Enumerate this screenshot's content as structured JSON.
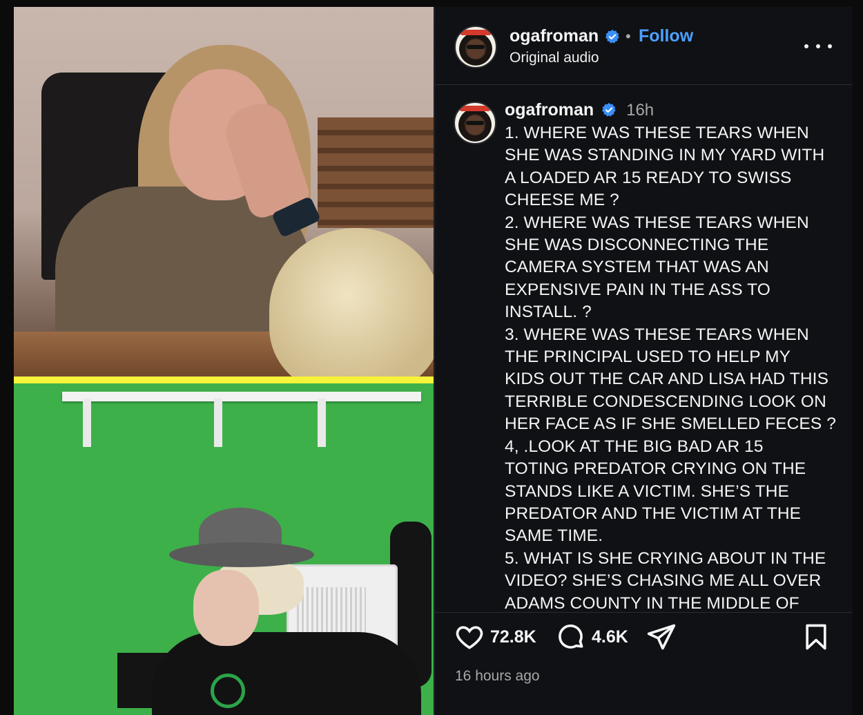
{
  "post": {
    "username": "ogafroman",
    "follow_label": "Follow",
    "separator": "•",
    "audio_label": "Original audio",
    "caption_time": "16h",
    "caption": "1. WHERE WAS THESE TEARS WHEN\nSHE WAS STANDING IN MY YARD WITH\nA LOADED AR 15 READY TO SWISS\nCHEESE ME ?\n2. WHERE WAS THESE TEARS WHEN\nSHE WAS DISCONNECTING THE\nCAMERA SYSTEM THAT WAS AN\nEXPENSIVE PAIN IN THE ASS TO\nINSTALL. ?\n3. WHERE WAS THESE TEARS WHEN\nTHE PRINCIPAL USED TO HELP MY\nKIDS OUT THE CAR AND LISA HAD THIS\nTERRIBLE CONDESCENDING LOOK ON\nHER FACE AS IF SHE SMELLED FECES ?\n4, .LOOK AT THE BIG BAD AR 15\nTOTING PREDATOR CRYING ON THE\nSTANDS LIKE A VICTIM. SHE’S THE\nPREDATOR AND THE VICTIM AT THE\nSAME TIME.\n5. WHAT IS SHE CRYING ABOUT IN THE\nVIDEO? SHE’S CHASING ME ALL OVER\nADAMS COUNTY IN THE MIDDLE OF",
    "likes": "72.8K",
    "comments": "4.6K",
    "time_ago": "16 hours ago"
  },
  "icons": {
    "verified": "verified-badge-icon",
    "more": "more-options-icon",
    "like": "heart-icon",
    "comment": "comment-icon",
    "share": "share-icon",
    "save": "bookmark-icon"
  },
  "colors": {
    "accent": "#4ca0ff",
    "verified": "#3b8ff6",
    "background": "#0f1114",
    "muted_text": "#a8a8a8",
    "media_divider": "#f7f23a"
  }
}
